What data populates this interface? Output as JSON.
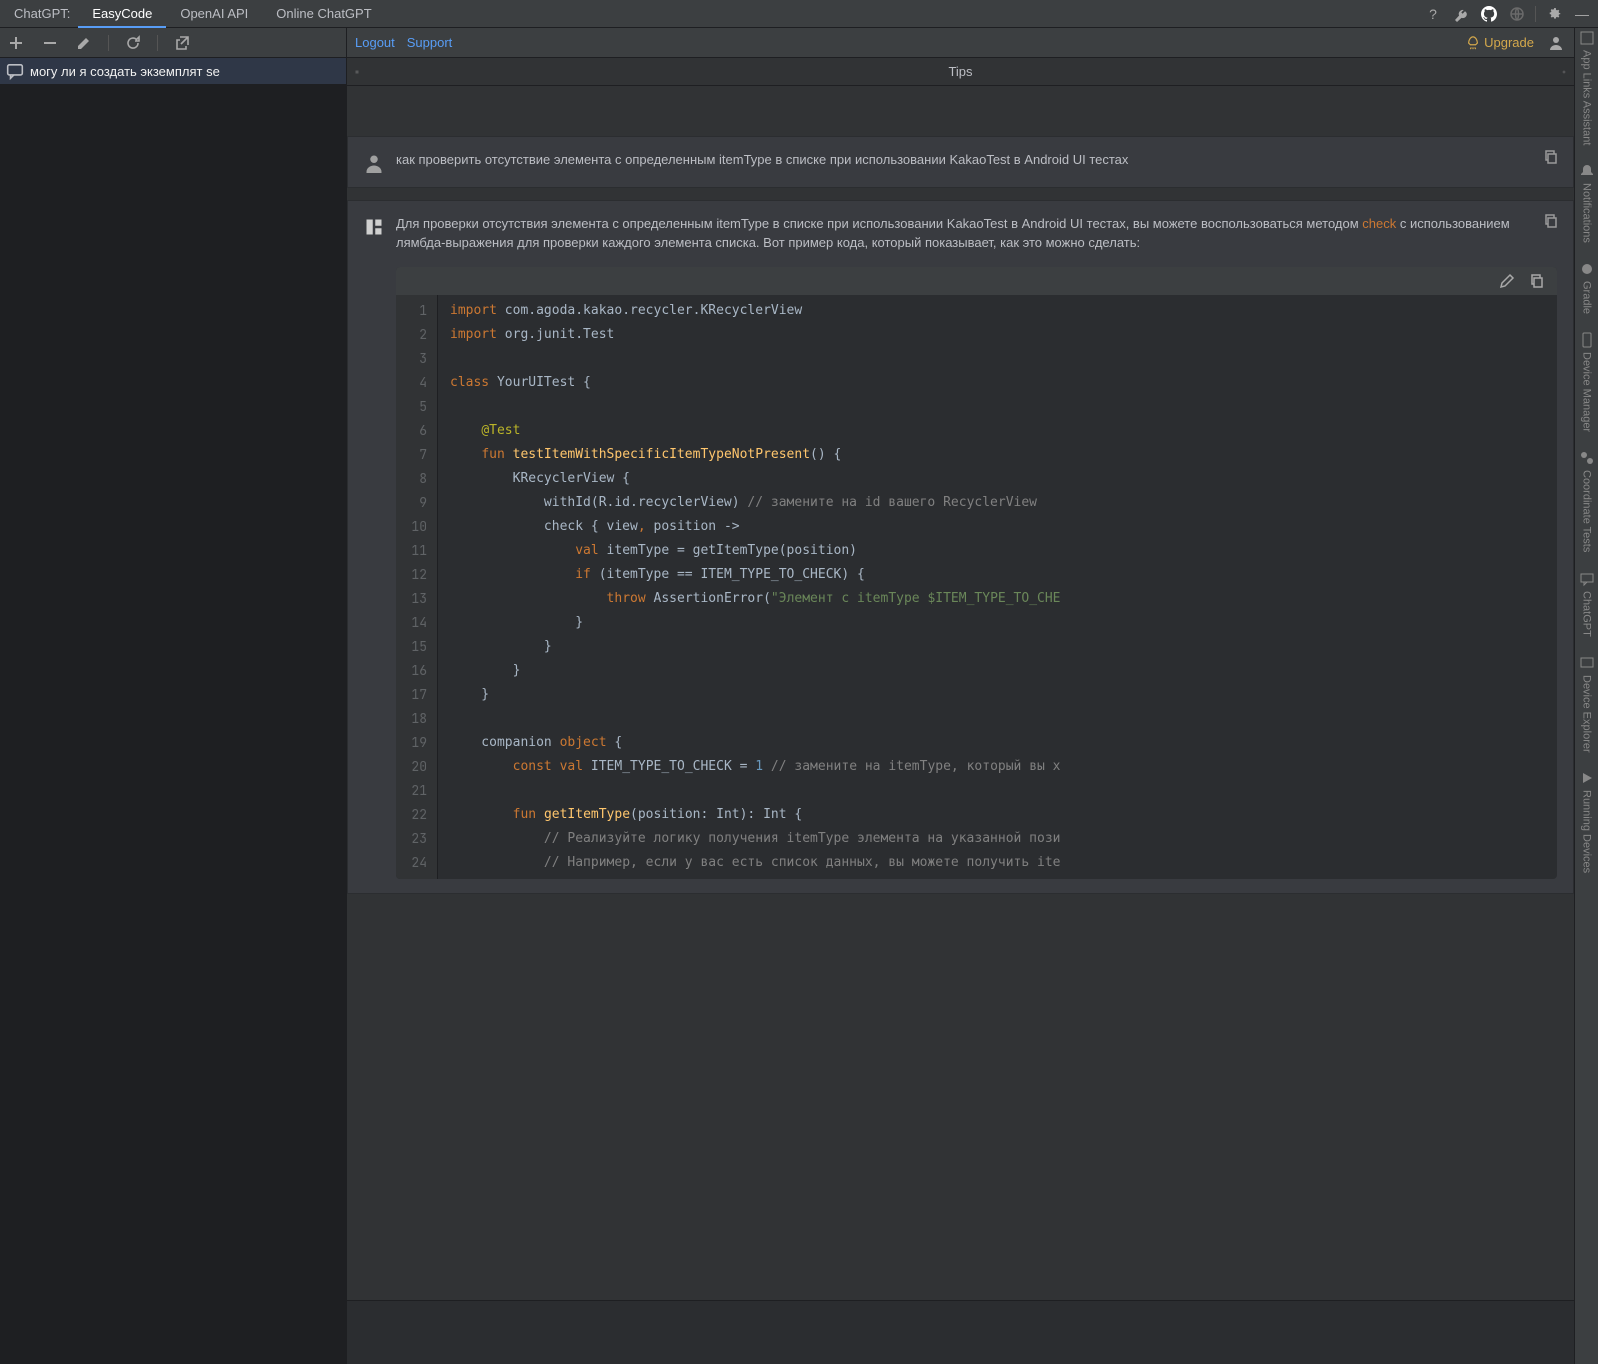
{
  "topTabs": {
    "label": "ChatGPT:",
    "tabs": [
      "EasyCode",
      "OpenAI API",
      "Online ChatGPT"
    ],
    "activeIndex": 0
  },
  "leftToolbarIcons": [
    "plus",
    "minus",
    "pencil",
    "refresh",
    "open-external"
  ],
  "history": {
    "items": [
      {
        "text": "могу ли я создать экземплят se"
      }
    ],
    "selectedIndex": 0
  },
  "mainHeader": {
    "logout": "Logout",
    "support": "Support",
    "upgrade": "Upgrade"
  },
  "tipsBar": {
    "label": "Tips"
  },
  "userMsg": {
    "text": "как проверить отсутствие элемента с определенным itemType в списке при использовании KakaoTest в Android UI тестах"
  },
  "assistantMsg": {
    "intro_part1": "Для проверки отсутствия элемента с определенным itemType в списке при использовании KakaoTest в Android UI тестах, вы можете воспользоваться методом ",
    "intro_link": "check",
    "intro_part2": " с использованием лямбда-выражения для проверки каждого элемента списка. Вот пример кода, который показывает, как это можно сделать:"
  },
  "code": {
    "lines": [
      [
        {
          "t": "kw",
          "v": "import"
        },
        {
          "t": "",
          "v": " com.agoda.kakao.recycler.KRecyclerView"
        }
      ],
      [
        {
          "t": "kw",
          "v": "import"
        },
        {
          "t": "",
          "v": " org.junit.Test"
        }
      ],
      [],
      [
        {
          "t": "kw",
          "v": "class"
        },
        {
          "t": "",
          "v": " YourUITest {"
        }
      ],
      [],
      [
        {
          "t": "",
          "v": "    "
        },
        {
          "t": "at",
          "v": "@Test"
        }
      ],
      [
        {
          "t": "",
          "v": "    "
        },
        {
          "t": "kw",
          "v": "fun"
        },
        {
          "t": "",
          "v": " "
        },
        {
          "t": "fn",
          "v": "testItemWithSpecificItemTypeNotPresent"
        },
        {
          "t": "",
          "v": "() {"
        }
      ],
      [
        {
          "t": "",
          "v": "        KRecyclerView {"
        }
      ],
      [
        {
          "t": "",
          "v": "            withId(R.id.recyclerView) "
        },
        {
          "t": "cmt",
          "v": "// замените на id вашего RecyclerView"
        }
      ],
      [
        {
          "t": "",
          "v": "            check { view"
        },
        {
          "t": "kw",
          "v": ","
        },
        {
          "t": "",
          "v": " position ->"
        }
      ],
      [
        {
          "t": "",
          "v": "                "
        },
        {
          "t": "kw",
          "v": "val"
        },
        {
          "t": "",
          "v": " itemType = getItemType(position)"
        }
      ],
      [
        {
          "t": "",
          "v": "                "
        },
        {
          "t": "kw",
          "v": "if"
        },
        {
          "t": "",
          "v": " (itemType == ITEM_TYPE_TO_CHECK) {"
        }
      ],
      [
        {
          "t": "",
          "v": "                    "
        },
        {
          "t": "kw",
          "v": "throw"
        },
        {
          "t": "",
          "v": " AssertionError("
        },
        {
          "t": "str",
          "v": "\"Элемент с itemType $ITEM_TYPE_TO_CHE"
        }
      ],
      [
        {
          "t": "",
          "v": "                }"
        }
      ],
      [
        {
          "t": "",
          "v": "            }"
        }
      ],
      [
        {
          "t": "",
          "v": "        }"
        }
      ],
      [
        {
          "t": "",
          "v": "    }"
        }
      ],
      [],
      [
        {
          "t": "",
          "v": "    companion "
        },
        {
          "t": "kw",
          "v": "object"
        },
        {
          "t": "",
          "v": " {"
        }
      ],
      [
        {
          "t": "",
          "v": "        "
        },
        {
          "t": "kw",
          "v": "const"
        },
        {
          "t": "",
          "v": " "
        },
        {
          "t": "kw",
          "v": "val"
        },
        {
          "t": "",
          "v": " ITEM_TYPE_TO_CHECK = "
        },
        {
          "t": "num",
          "v": "1"
        },
        {
          "t": "",
          "v": " "
        },
        {
          "t": "cmt",
          "v": "// замените на itemType, который вы х"
        }
      ],
      [],
      [
        {
          "t": "",
          "v": "        "
        },
        {
          "t": "kw",
          "v": "fun"
        },
        {
          "t": "",
          "v": " "
        },
        {
          "t": "fn",
          "v": "getItemType"
        },
        {
          "t": "",
          "v": "(position: Int): Int {"
        }
      ],
      [
        {
          "t": "",
          "v": "            "
        },
        {
          "t": "cmt",
          "v": "// Реализуйте логику получения itemType элемента на указанной пози"
        }
      ],
      [
        {
          "t": "",
          "v": "            "
        },
        {
          "t": "cmt",
          "v": "// Например, если у вас есть список данных, вы можете получить ite"
        }
      ]
    ]
  },
  "rightStrip": {
    "items": [
      "App Links Assistant",
      "Notifications",
      "Gradle",
      "Device Manager",
      "Coordinate Tests",
      "ChatGPT",
      "Device Explorer",
      "Running Devices"
    ]
  },
  "inputBar": {
    "placeholder": ""
  }
}
